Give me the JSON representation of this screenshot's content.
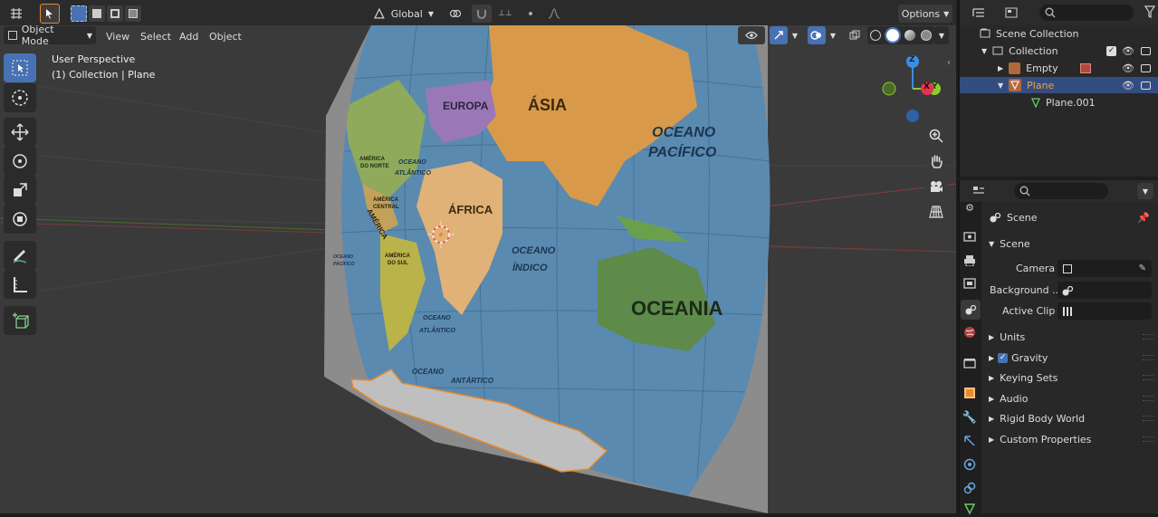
{
  "header": {
    "orientation": "Global",
    "options_label": "Options"
  },
  "viewport_header": {
    "mode_label": "Object Mode",
    "menus": [
      "View",
      "Select",
      "Add",
      "Object"
    ]
  },
  "viewport": {
    "perspective_label": "User Perspective",
    "context_label": "(1) Collection | Plane",
    "map_labels": {
      "europa": "EUROPA",
      "asia": "ÁSIA",
      "oceano_pacifico_1": "OCEANO",
      "oceano_pacifico_2": "PACÍFICO",
      "africa": "ÁFRICA",
      "oceano_indico_1": "OCEANO",
      "oceano_indico_2": "ÍNDICO",
      "oceania": "OCEANIA",
      "america_norte_1": "AMÉRICA",
      "america_norte_2": "DO NORTE",
      "oceano_atlantico_n_1": "OCEANO",
      "oceano_atlantico_n_2": "ATLÂNTICO",
      "america_central_1": "AMÉRICA",
      "america_central_2": "CENTRAL",
      "america_word": "AMÉRICA",
      "america_sul_1": "AMÉRICA",
      "america_sul_2": "DO SUL",
      "oceano_atlantico_s_1": "OCEANO",
      "oceano_atlantico_s_2": "ATLÂNTICO",
      "oceano_pacifico_s_1": "OCEANO",
      "oceano_pacifico_s_2": "PACÍFICO",
      "oceano_antartico_1": "OCEANO",
      "oceano_antartico_2": "ANTÁRTICO"
    },
    "gizmo": {
      "z": "Z",
      "x": "X",
      "y": "Y"
    }
  },
  "outliner": {
    "scene_collection": "Scene Collection",
    "items": [
      {
        "label": "Collection"
      },
      {
        "label": "Empty"
      },
      {
        "label": "Plane"
      },
      {
        "label": "Plane.001"
      }
    ]
  },
  "properties": {
    "header_title": "Scene",
    "panel_title": "Scene",
    "camera_label": "Camera",
    "background_label": "Background ...",
    "active_clip_label": "Active Clip",
    "sections": [
      "Units",
      "Gravity",
      "Keying Sets",
      "Audio",
      "Rigid Body World",
      "Custom Properties"
    ]
  },
  "colors": {
    "accent": "#4772b3",
    "selection_outline": "#e8892a",
    "axis_x": "#e2344e",
    "axis_y": "#8ccc2a",
    "axis_z": "#3a8de3"
  }
}
